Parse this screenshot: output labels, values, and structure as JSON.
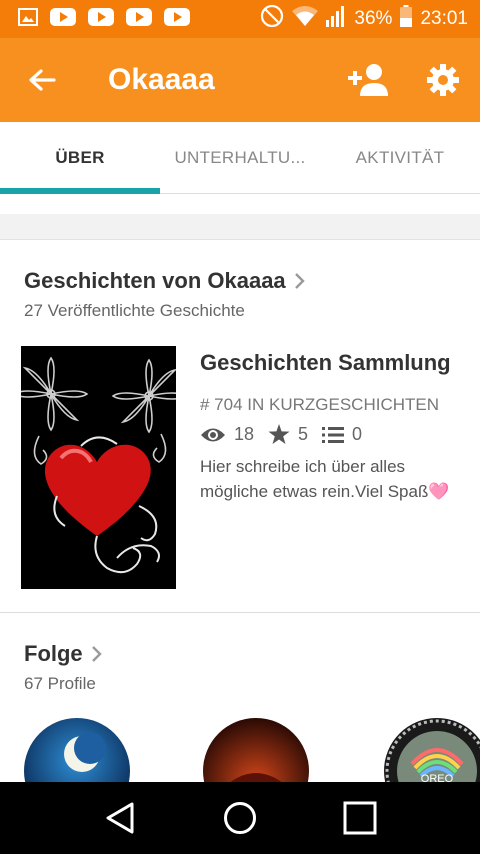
{
  "status_bar": {
    "battery": "36%",
    "time": "23:01",
    "icons": [
      "gallery-icon",
      "youtube-icon",
      "youtube-icon",
      "youtube-icon",
      "youtube-icon",
      "do-not-disturb-icon",
      "wifi-icon",
      "signal-icon",
      "battery-icon"
    ]
  },
  "app_bar": {
    "title": "Okaaaa",
    "icons": [
      "back-arrow-icon",
      "add-person-icon",
      "gear-icon"
    ]
  },
  "tabs": [
    {
      "label": "ÜBER",
      "active": true
    },
    {
      "label": "UNTERHALTU...",
      "active": false
    },
    {
      "label": "AKTIVITÄT",
      "active": false
    }
  ],
  "stories": {
    "title": "Geschichten von Okaaaa",
    "subtitle": "27 Veröffentlichte Geschichte",
    "item": {
      "title": "Geschichten Sammlung",
      "rank": "# 704 IN KURZGESCHICHTEN",
      "views": "18",
      "votes": "5",
      "parts": "0",
      "description": "Hier schreibe ich über alles mögliche etwas rein.Viel Spaß",
      "description_emoji": "🩷"
    }
  },
  "follow": {
    "title": "Folge",
    "subtitle": "67 Profile",
    "avatar_3_text": "OREO"
  },
  "colors": {
    "status_bar": "#f47d0a",
    "app_bar": "#f7901e",
    "tab_indicator": "#17a3a8"
  }
}
